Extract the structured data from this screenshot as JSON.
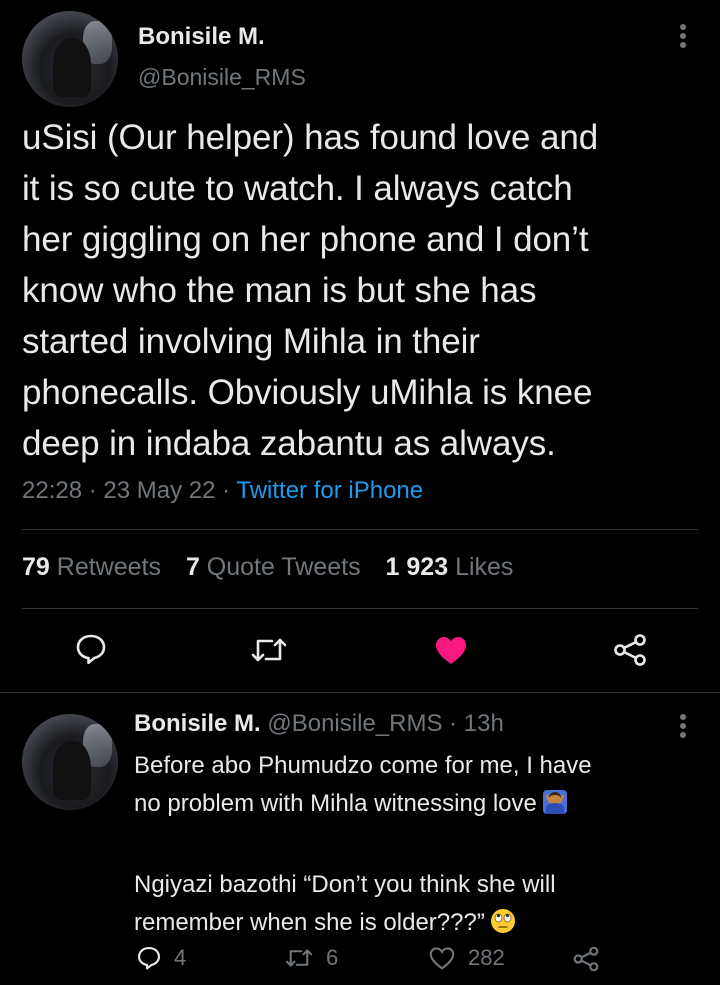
{
  "tweet": {
    "author_name": "Bonisile M.",
    "author_handle": "@Bonisile_RMS",
    "more_icon": "more-vertical-icon",
    "lines": [
      "uSisi (Our helper) has found love and",
      "it is so cute to watch. I always catch",
      "her giggling on her phone and I don’t",
      "know who the man is but she has",
      "started involving Mihla in their",
      "phonecalls. Obviously uMihla is knee",
      "deep in indaba zabantu as always."
    ],
    "time": "22:28 · 23 May 22 · ",
    "source": "Twitter for iPhone"
  },
  "stats": {
    "retweets_count": "79",
    "retweets_label": "Retweets",
    "quotes_count": "7",
    "quotes_label": "Quote Tweets",
    "likes_count": "1 923",
    "likes_label": "Likes"
  },
  "actions": {
    "icons": [
      "reply-icon",
      "retweet-icon",
      "like-icon",
      "share-icon"
    ],
    "like_color": "#f91880",
    "muted_color": "#71767b"
  },
  "reply": {
    "author_name": "Bonisile M.",
    "author_handle": "@Bonisile_RMS",
    "age": "· 13h",
    "line1": "Before abo Phumudzo come for me, I have",
    "line2": "no problem with Mihla witnessing love",
    "line3": "Ngiyazi bazothi “Don’t you think she will",
    "line4": "remember when she is older???”",
    "reply_count": "4",
    "retweet_count": "6",
    "like_count": "282"
  }
}
